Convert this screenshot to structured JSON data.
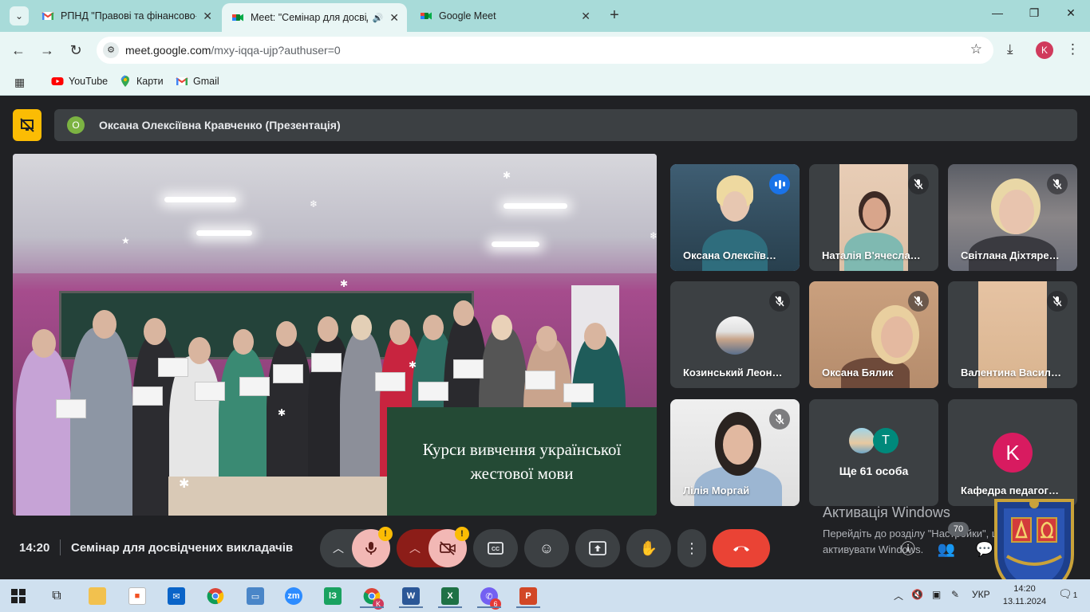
{
  "browser": {
    "tabs": [
      {
        "title": "РПНД \"Правові та фінансово-",
        "active": false
      },
      {
        "title": "Meet: \"Семінар для досвід",
        "active": true
      },
      {
        "title": "Google Meet",
        "active": false
      }
    ],
    "url_host": "meet.google.com",
    "url_rest": "/mxy-iqqa-ujp?authuser=0",
    "profile_initial": "K",
    "bookmarks": [
      "YouTube",
      "Карти",
      "Gmail"
    ]
  },
  "meet": {
    "presenter_initial": "О",
    "presenter_label": "Оксана Олексіївна Кравченко (Презентація)",
    "slide_caption_line1": "Курси вивчення української",
    "slide_caption_line2": "жестової мови",
    "participants": [
      {
        "name": "Оксана Олексіїв…",
        "speaking": true
      },
      {
        "name": "Наталія В'ячесла…",
        "muted": true
      },
      {
        "name": "Світлана Діхтяре…",
        "muted": true
      },
      {
        "name": "Козинський Леон…",
        "muted": true
      },
      {
        "name": "Оксана Бялик",
        "muted": true
      },
      {
        "name": "Валентина Васил…",
        "muted": true
      },
      {
        "name": "Лілія Моргай",
        "muted": true
      },
      {
        "name": "Ще 61 особа",
        "avatar_letter": "T"
      },
      {
        "name": "Кафедра педагог…",
        "avatar_letter": "K"
      }
    ],
    "activation_title": "Активація Windows",
    "activation_line1": "Перейдіть до розділу \"Настройки\", щоб",
    "activation_line2": "активувати Windows.",
    "time": "14:20",
    "meeting_title": "Семінар для досвідчених викладачів",
    "warning_mark": "!",
    "people_count": "70",
    "colors": {
      "accent_blue": "#1a73e8",
      "end_call": "#ea4335",
      "warning": "#fbbc04"
    }
  },
  "taskbar": {
    "lang": "УКР",
    "clock_time": "14:20",
    "clock_date": "13.11.2024",
    "viber_badge": "6",
    "notif_count": "1",
    "chrome_badge": "K"
  }
}
